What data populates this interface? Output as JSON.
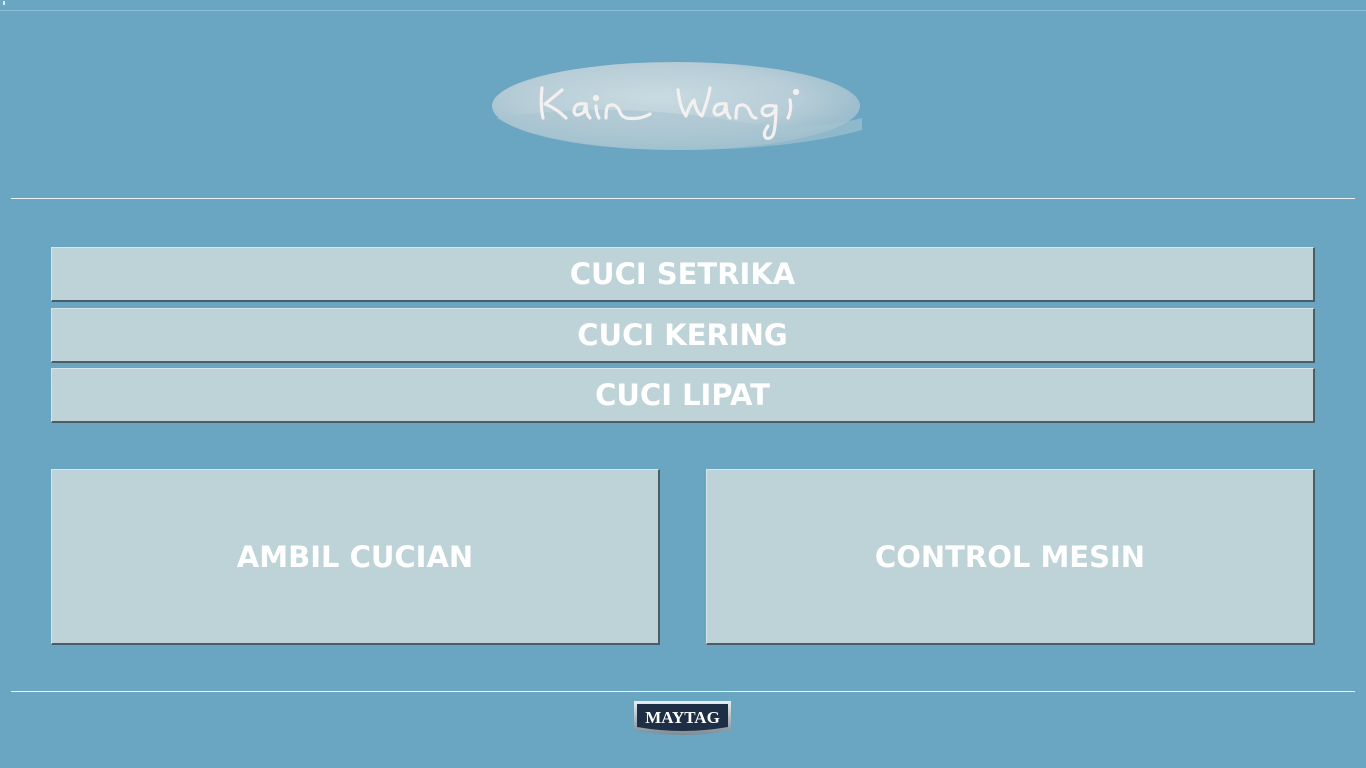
{
  "app": {
    "logo_text": "Kain Wangi",
    "brand_logo_text": "MAYTAG"
  },
  "menu": {
    "items": [
      {
        "label": "CUCI SETRIKA"
      },
      {
        "label": "CUCI KERING"
      },
      {
        "label": "CUCI LIPAT"
      }
    ]
  },
  "actions": {
    "pickup_label": "AMBIL CUCIAN",
    "control_label": "CONTROL MESIN"
  },
  "colors": {
    "background": "#6aa5c1",
    "button_fill": "#bed3d7",
    "button_text": "#ffffff"
  }
}
